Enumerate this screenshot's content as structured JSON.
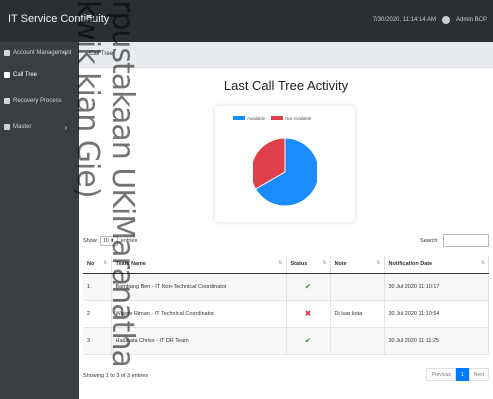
{
  "app": {
    "title": "IT Service Continuity",
    "menu_icon": "≡"
  },
  "topbar": {
    "datetime": "7/30/2020, 11:14:14 AM",
    "user": "Admin BCP"
  },
  "sidebar": {
    "items": [
      {
        "label": "Account Management",
        "has_submenu": true
      },
      {
        "label": "Call Tree",
        "has_submenu": false,
        "active": true
      },
      {
        "label": "Recovery Process",
        "has_submenu": false
      },
      {
        "label": "Master",
        "has_submenu": true
      }
    ]
  },
  "breadcrumb": "Call Tree",
  "page_title": "Last Call Tree Activity",
  "chart_data": {
    "type": "pie",
    "legend": [
      "Available",
      "Not Available"
    ],
    "series": [
      {
        "name": "Available",
        "value": 2,
        "color": "#1a8cff"
      },
      {
        "name": "Not Available",
        "value": 1,
        "color": "#e0404a"
      }
    ]
  },
  "table_controls": {
    "show_label": "Show",
    "entries_value": "10",
    "entries_label": "entries",
    "search_label": "Search:"
  },
  "table": {
    "columns": [
      "No",
      "Team Name",
      "Status",
      "Note",
      "Notification Date"
    ],
    "rows": [
      {
        "no": "1",
        "team": "Bambang Ben - IT Non-Technical Coordinator",
        "status": "ok",
        "note": "",
        "date": "30 Jul 2020 11:10:17"
      },
      {
        "no": "2",
        "team": "Wayne Riman - IT Technical Coordinator",
        "status": "no",
        "note": "Di luar kota",
        "date": "30 Jul 2020 11:10:54"
      },
      {
        "no": "3",
        "team": "Hadinata Chriss - IT DR Team",
        "status": "ok",
        "note": "",
        "date": "30 Jul 2020 11:11:25"
      }
    ]
  },
  "footer": {
    "info": "Showing 1 to 3 of 3 entries",
    "previous": "Previous",
    "page": "1",
    "next": "Next"
  },
  "watermark": "rpustakaan UKiMaranatha kwik kian Gie)"
}
